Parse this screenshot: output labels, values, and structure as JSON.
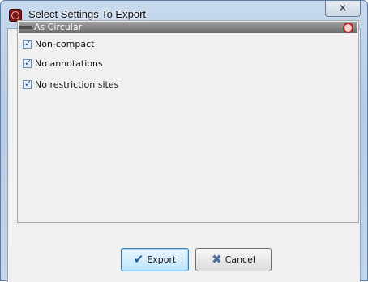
{
  "window": {
    "title": "Select Settings To Export",
    "close_glyph": "✕"
  },
  "panel": {
    "title": "As Circular",
    "options": [
      {
        "label": "Non-compact",
        "checked": true
      },
      {
        "label": "No annotations",
        "checked": true
      },
      {
        "label": "No restriction sites",
        "checked": true
      }
    ]
  },
  "buttons": {
    "export_label": "Export",
    "cancel_label": "Cancel"
  },
  "icons": {
    "app": "app-icon",
    "close": "close-icon",
    "panel_collapse": "collapse-icon",
    "panel_badge": "circular-badge-icon",
    "export": "checkmark-icon",
    "cancel": "x-cancel-icon"
  }
}
